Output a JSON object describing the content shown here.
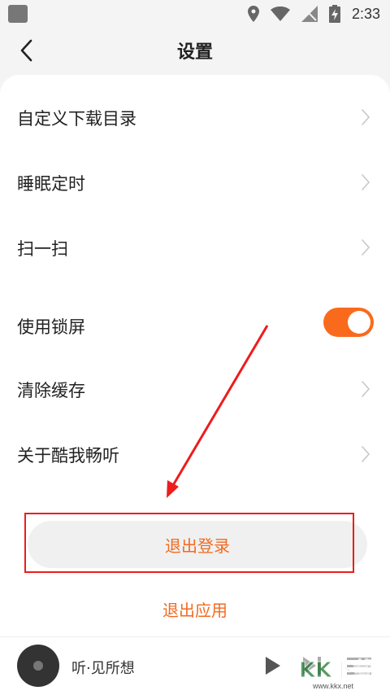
{
  "status_bar": {
    "time": "2:33"
  },
  "header": {
    "title": "设置"
  },
  "settings": {
    "items": [
      {
        "label": "自定义下载目录"
      },
      {
        "label": "睡眠定时"
      },
      {
        "label": "扫一扫"
      },
      {
        "label": "使用锁屏",
        "toggle_on": true
      },
      {
        "label": "清除缓存"
      },
      {
        "label": "关于酷我畅听"
      }
    ]
  },
  "actions": {
    "logout_label": "退出登录",
    "exit_app_label": "退出应用"
  },
  "player": {
    "track_title": "听·见所想"
  },
  "watermark": {
    "text": "www.kkx.net",
    "logo_text": "KK下载"
  },
  "colors": {
    "accent": "#f26a21",
    "toggle_on": "#fa6a1c",
    "annotation": "#ee1c1c"
  }
}
